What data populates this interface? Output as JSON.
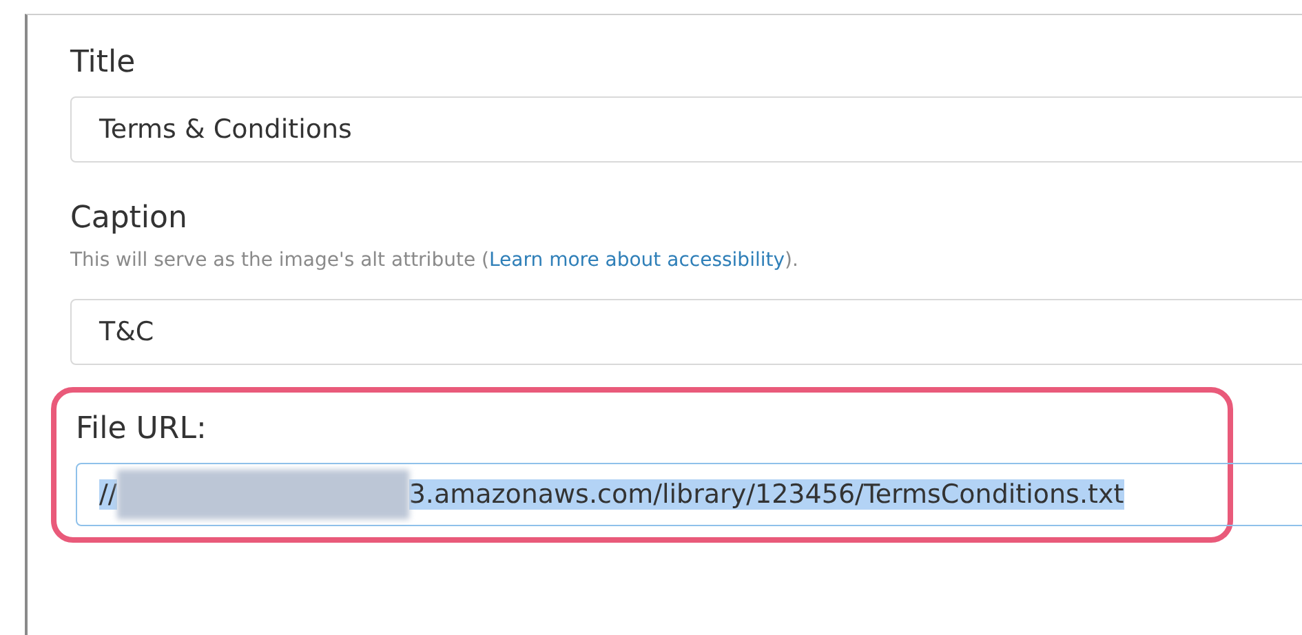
{
  "fields": [
    {
      "kind": "text",
      "label": "Title",
      "value": "Terms & Conditions"
    },
    {
      "kind": "text",
      "label": "Caption",
      "help": {
        "text": "This will serve as the image's alt attribute (",
        "link": "Learn more about accessibility",
        "after": ")."
      },
      "value": "T&C"
    },
    {
      "kind": "url",
      "label": "File URL:",
      "value_prefix": "//",
      "value_suffix": "3.amazonaws.com/library/123456/TermsConditions.txt",
      "selected": true,
      "highlighted": true
    }
  ]
}
